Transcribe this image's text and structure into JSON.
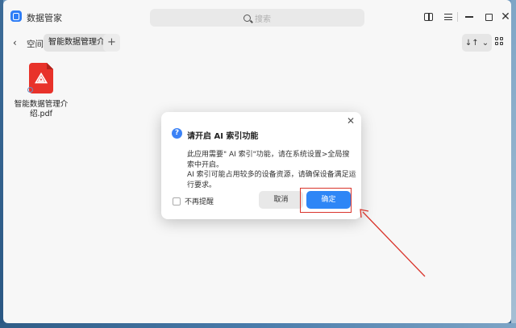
{
  "window": {
    "app_title": "数据管家",
    "search_placeholder": "搜索"
  },
  "toolbar": {
    "back_icon": "‹",
    "space_label": "空间",
    "current_folder": "智能数据管理介绍",
    "add_tab_label": "+",
    "sort_label": "↓↑",
    "sort_chevron": "⌄"
  },
  "titlebar_buttons": {
    "close": "✕"
  },
  "files": [
    {
      "name": "智能数据管理介绍.pdf",
      "type": "pdf"
    }
  ],
  "dialog": {
    "icon": "?",
    "title": "请开启 AI 索引功能",
    "line1": "此应用需要\" AI 索引\"功能，请在系统设置>全局搜索中开启。",
    "line2": "AI 索引可能占用较多的设备资源，请确保设备满足运行要求。",
    "dont_remind": "不再提醒",
    "cancel": "取消",
    "confirm": "确定",
    "close": "✕"
  },
  "colors": {
    "accent": "#2e86f6",
    "pdf": "#e8322a",
    "annotation": "#d9342b"
  }
}
